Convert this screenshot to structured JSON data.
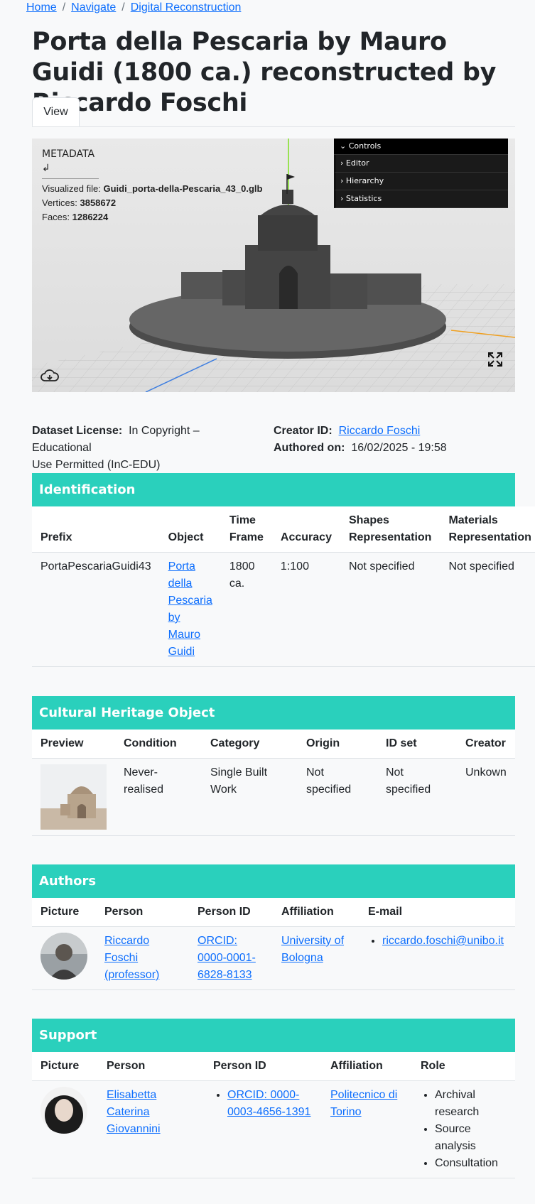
{
  "breadcrumb": {
    "home": "Home",
    "navigate": "Navigate",
    "current": "Digital Reconstruction"
  },
  "title": "Porta della Pescaria by Mauro Guidi (1800 ca.) reconstructed by Riccardo Foschi",
  "tabs": {
    "view": "View"
  },
  "viewer": {
    "metadata_title": "METADATA ↲",
    "file_label": "Visualized file:",
    "file_name": "Guidi_porta-della-Pescaria_43_0.glb",
    "vertices_label": "Vertices:",
    "vertices": "3858672",
    "faces_label": "Faces:",
    "faces": "1286224",
    "gui": {
      "controls": "Controls",
      "editor": "Editor",
      "hierarchy": "Hierarchy",
      "statistics": "Statistics"
    }
  },
  "info": {
    "license_label": "Dataset License:",
    "license_value": "In Copyright – Educational",
    "license_value2": "Use Permitted (InC-EDU)",
    "creator_label": "Creator ID:",
    "creator_value": "Riccardo Foschi",
    "authored_label": "Authored on:",
    "authored_value": "16/02/2025 - 19:58"
  },
  "identification": {
    "title": "Identification",
    "headers": [
      "Prefix",
      "Object",
      "Time Frame",
      "Accuracy",
      "Shapes Representation",
      "Materials Representation"
    ],
    "row": {
      "prefix": "PortaPescariaGuidi43",
      "object": "Porta della Pescaria by Mauro Guidi",
      "time_frame": "1800 ca.",
      "accuracy": "1:100",
      "shapes": "Not specified",
      "materials": "Not specified"
    }
  },
  "heritage": {
    "title": "Cultural Heritage Object",
    "headers": [
      "Preview",
      "Condition",
      "Category",
      "Origin",
      "ID set",
      "Creator"
    ],
    "row": {
      "condition": "Never-realised",
      "category": "Single Built Work",
      "origin": "Not specified",
      "id_set": "Not specified",
      "creator": "Unkown"
    }
  },
  "authors": {
    "title": "Authors",
    "headers": [
      "Picture",
      "Person",
      "Person ID",
      "Affiliation",
      "E-mail"
    ],
    "row": {
      "person": "Riccardo Foschi (professor)",
      "person_id": "ORCID: 0000-0001-6828-8133",
      "affiliation": "University of Bologna",
      "email": "riccardo.foschi@unibo.it"
    }
  },
  "support": {
    "title": "Support",
    "headers": [
      "Picture",
      "Person",
      "Person ID",
      "Affiliation",
      "Role"
    ],
    "row": {
      "person": "Elisabetta Caterina Giovannini",
      "person_id": "ORCID: 0000-0003-4656-1391",
      "affiliation": "Politecnico di Torino",
      "roles": [
        "Archival research",
        "Source analysis",
        "Consultation"
      ]
    }
  }
}
